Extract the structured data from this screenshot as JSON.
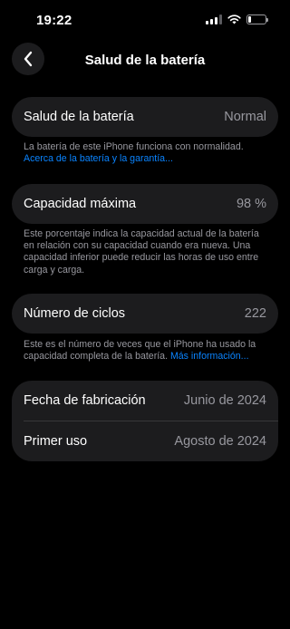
{
  "status_bar": {
    "time": "19:22",
    "battery_level": 0.15
  },
  "nav": {
    "title": "Salud de la batería"
  },
  "battery_health": {
    "label": "Salud de la batería",
    "value": "Normal",
    "note": "La batería de este iPhone funciona con normalidad.",
    "link": "Acerca de la batería y la garantía..."
  },
  "max_capacity": {
    "label": "Capacidad máxima",
    "value": "98 %",
    "note": "Este porcentaje indica la capacidad actual de la batería en relación con su capacidad cuando era nueva. Una capacidad inferior puede reducir las horas de uso entre carga y carga."
  },
  "cycle_count": {
    "label": "Número de ciclos",
    "value": "222",
    "note": "Este es el número de veces que el iPhone ha usado la capacidad completa de la batería.",
    "link": "Más información..."
  },
  "dates": {
    "manufacture_label": "Fecha de fabricación",
    "manufacture_value": "Junio de 2024",
    "first_use_label": "Primer uso",
    "first_use_value": "Agosto de 2024"
  },
  "colors": {
    "link": "#0a84ff",
    "card": "#1c1c1e",
    "secondary_text": "#98989f"
  }
}
